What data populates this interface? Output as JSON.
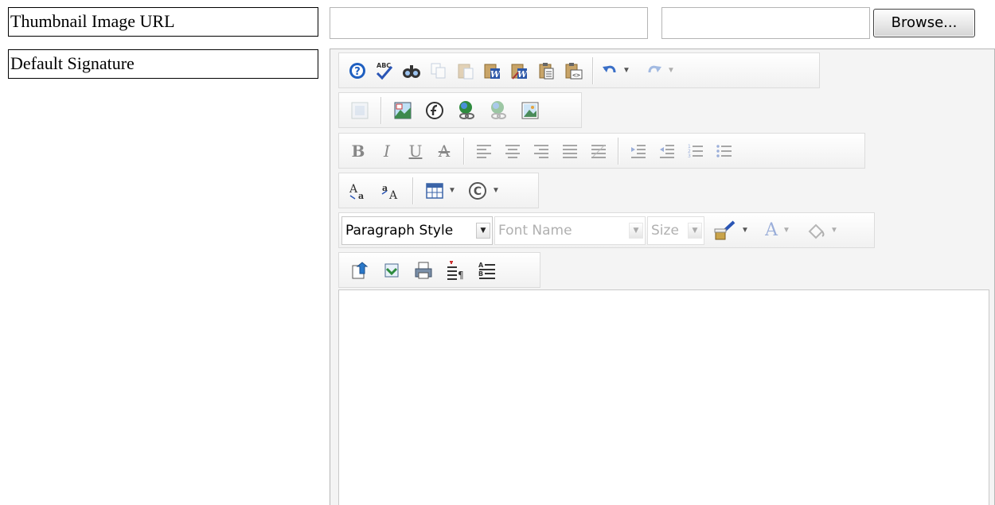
{
  "labels": {
    "thumbnail": "Thumbnail Image URL",
    "signature": "Default Signature"
  },
  "inputs": {
    "thumbnail_url_value": "",
    "file_path_value": ""
  },
  "buttons": {
    "browse": "Browse..."
  },
  "editor": {
    "paragraph_style": "Paragraph Style",
    "font_name": "Font Name",
    "size": "Size",
    "content": ""
  },
  "icons": {
    "toolbar1": [
      "help-icon",
      "spellcheck-icon",
      "find-icon",
      "copy-icon",
      "paste-icon",
      "paste-from-word-icon",
      "paste-from-word-clean-icon",
      "paste-plain-text-icon",
      "paste-html-icon",
      "undo-icon",
      "redo-icon"
    ],
    "toolbar2": [
      "image-manager-icon",
      "image-map-icon",
      "flash-icon",
      "hyperlink-icon",
      "remove-link-icon",
      "insert-image-icon"
    ],
    "toolbar3": [
      "bold-icon",
      "italic-icon",
      "underline-icon",
      "strikethrough-icon",
      "align-left-icon",
      "align-center-icon",
      "align-right-icon",
      "justify-icon",
      "justify-none-icon",
      "indent-icon",
      "outdent-icon",
      "numbered-list-icon",
      "bullet-list-icon"
    ],
    "toolbar4": [
      "superscript-icon",
      "subscript-icon",
      "table-icon",
      "symbol-icon"
    ],
    "toolbar5": [
      "format-stripper-icon",
      "font-color-icon",
      "background-color-icon"
    ],
    "toolbar6": [
      "export-icon",
      "import-icon",
      "print-icon",
      "insert-paragraph-icon",
      "format-list-icon"
    ]
  },
  "colors": {
    "help_blue": "#1e5fc0",
    "link_green": "#2e8b3e"
  }
}
